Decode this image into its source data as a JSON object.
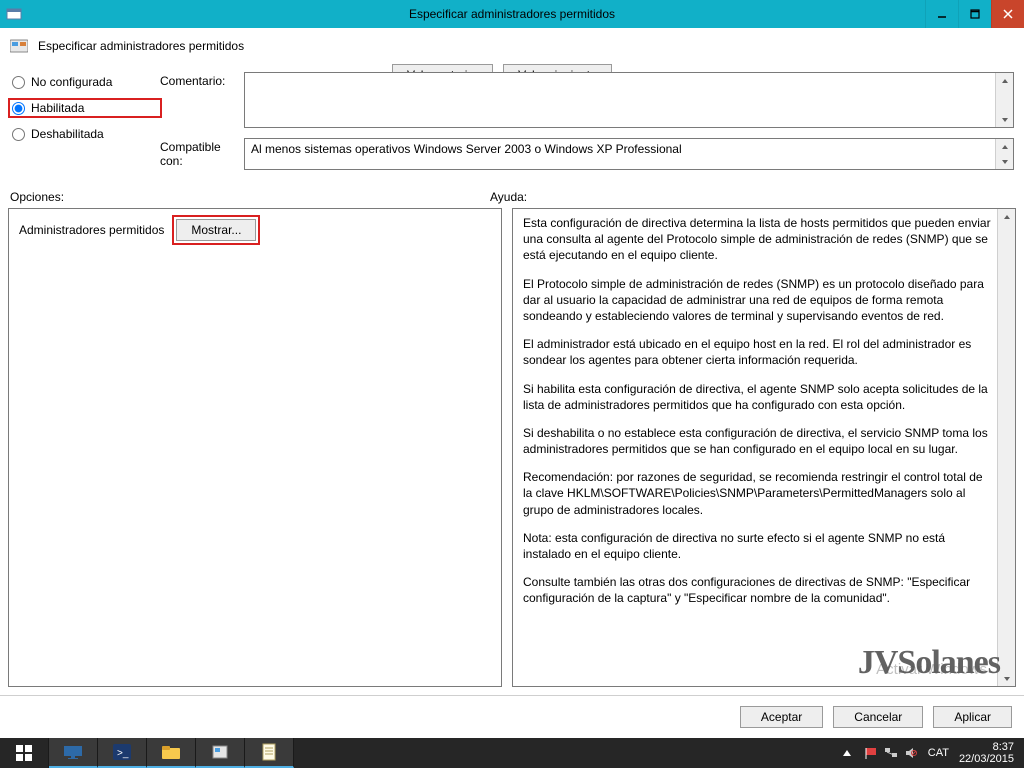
{
  "window": {
    "title": "Especificar administradores permitidos"
  },
  "header": {
    "policy_name": "Especificar administradores permitidos",
    "prev_btn": "Valor anterior",
    "next_btn": "Valor siguiente"
  },
  "radios": {
    "not_configured": "No configurada",
    "enabled": "Habilitada",
    "disabled": "Deshabilitada",
    "selected": "enabled"
  },
  "info": {
    "comment_label": "Comentario:",
    "comment_value": "",
    "compat_label": "Compatible con:",
    "compat_value": "Al menos sistemas operativos Windows Server 2003 o Windows XP Professional"
  },
  "sections": {
    "options_label": "Opciones:",
    "help_label": "Ayuda:"
  },
  "options": {
    "permitted_managers_label": "Administradores permitidos",
    "show_btn": "Mostrar..."
  },
  "help": {
    "paragraphs": [
      "Esta configuración de directiva determina la lista de hosts permitidos que pueden enviar una consulta al agente del Protocolo simple de administración de redes (SNMP) que se está ejecutando en el equipo cliente.",
      "El Protocolo simple de administración de redes (SNMP) es un protocolo diseñado para dar al usuario la capacidad de administrar una red de equipos de forma remota sondeando y estableciendo valores de terminal y supervisando eventos de red.",
      "El administrador está ubicado en el equipo host en la red. El rol del administrador es sondear los agentes para obtener cierta información requerida.",
      "Si habilita esta configuración de directiva, el agente SNMP solo acepta solicitudes de la lista de administradores permitidos que ha configurado con esta opción.",
      "Si deshabilita o no establece esta configuración de directiva, el servicio SNMP toma los administradores permitidos que se han configurado en el equipo local en su lugar.",
      "Recomendación: por razones de seguridad, se recomienda restringir el control total de la clave HKLM\\SOFTWARE\\Policies\\SNMP\\Parameters\\PermittedManagers solo al grupo de administradores locales.",
      "Nota: esta configuración de directiva no surte efecto si el agente SNMP no está instalado en el equipo cliente.",
      "Consulte también las otras dos configuraciones de directivas de SNMP: \"Especificar configuración de la captura\" y \"Especificar nombre de la comunidad\"."
    ],
    "activate_watermark": "Activar Windows"
  },
  "footer": {
    "ok": "Aceptar",
    "cancel": "Cancelar",
    "apply": "Aplicar"
  },
  "logo": "JVSolanes",
  "taskbar": {
    "lang": "CAT",
    "time": "8:37",
    "date": "22/03/2015"
  }
}
